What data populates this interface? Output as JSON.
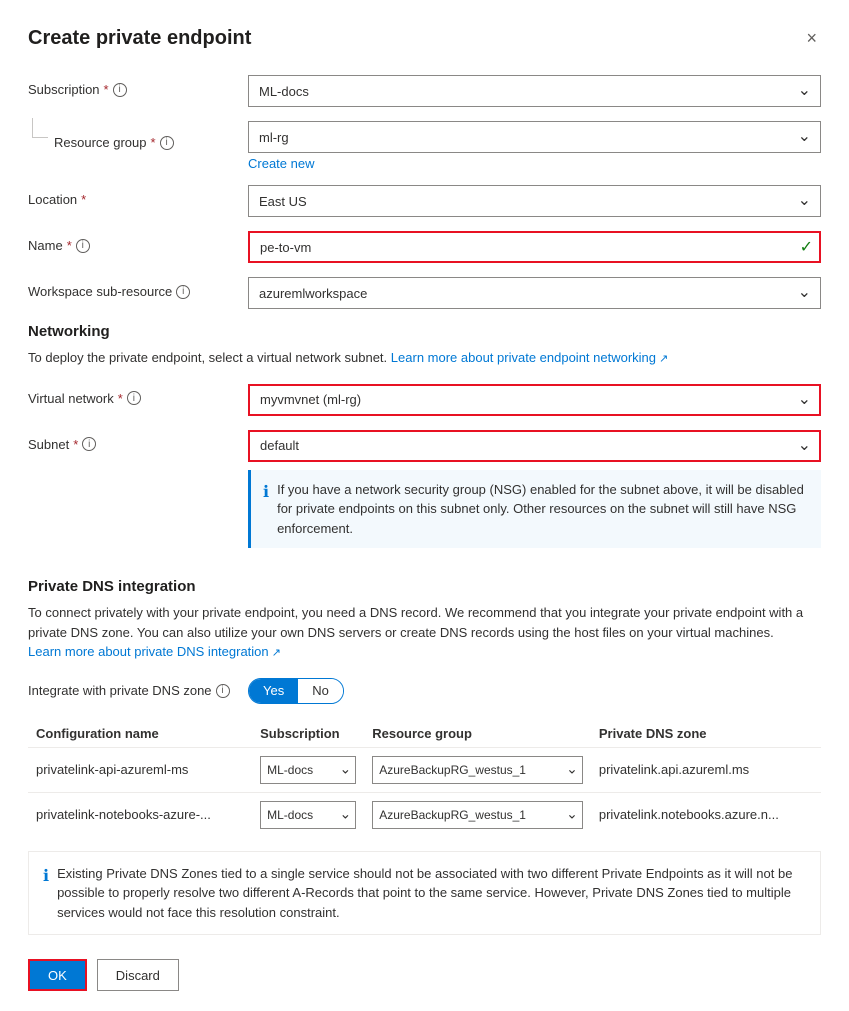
{
  "dialog": {
    "title": "Create private endpoint",
    "close_label": "×"
  },
  "form": {
    "subscription_label": "Subscription",
    "subscription_required": "*",
    "subscription_value": "ML-docs",
    "resource_group_label": "Resource group",
    "resource_group_required": "*",
    "resource_group_value": "ml-rg",
    "create_new_label": "Create new",
    "location_label": "Location",
    "location_required": "*",
    "location_value": "East US",
    "name_label": "Name",
    "name_required": "*",
    "name_value": "pe-to-vm",
    "workspace_sub_label": "Workspace sub-resource",
    "workspace_sub_value": "azuremlworkspace"
  },
  "networking": {
    "section_title": "Networking",
    "description": "To deploy the private endpoint, select a virtual network subnet.",
    "learn_more_text": "Learn more about private endpoint networking",
    "virtual_network_label": "Virtual network",
    "virtual_network_required": "*",
    "virtual_network_value": "myvmvnet (ml-rg)",
    "subnet_label": "Subnet",
    "subnet_required": "*",
    "subnet_value": "default",
    "nsg_info": "If you have a network security group (NSG) enabled for the subnet above, it will be disabled for private endpoints on this subnet only. Other resources on the subnet will still have NSG enforcement."
  },
  "private_dns": {
    "section_title": "Private DNS integration",
    "description": "To connect privately with your private endpoint, you need a DNS record. We recommend that you integrate your private endpoint with a private DNS zone. You can also utilize your own DNS servers or create DNS records using the host files on your virtual machines.",
    "learn_more_text": "Learn more about private DNS integration",
    "integrate_label": "Integrate with private DNS zone",
    "toggle_yes": "Yes",
    "toggle_no": "No",
    "table_headers": {
      "config_name": "Configuration name",
      "subscription": "Subscription",
      "resource_group": "Resource group",
      "private_dns_zone": "Private DNS zone"
    },
    "rows": [
      {
        "config_name": "privatelink-api-azureml-ms",
        "subscription": "ML-docs",
        "resource_group": "AzureBackupRG_westus_1",
        "private_dns_zone": "privatelink.api.azureml.ms"
      },
      {
        "config_name": "privatelink-notebooks-azure-...",
        "subscription": "ML-docs",
        "resource_group": "AzureBackupRG_westus_1",
        "private_dns_zone": "privatelink.notebooks.azure.n..."
      }
    ],
    "warning_text": "Existing Private DNS Zones tied to a single service should not be associated with two different Private Endpoints as it will not be possible to properly resolve two different A-Records that point to the same service. However, Private DNS Zones tied to multiple services would not face this resolution constraint."
  },
  "footer": {
    "ok_label": "OK",
    "discard_label": "Discard"
  },
  "icons": {
    "close": "×",
    "check": "✓",
    "info": "i",
    "chevron_down": "⌄",
    "info_circle": "ℹ"
  }
}
